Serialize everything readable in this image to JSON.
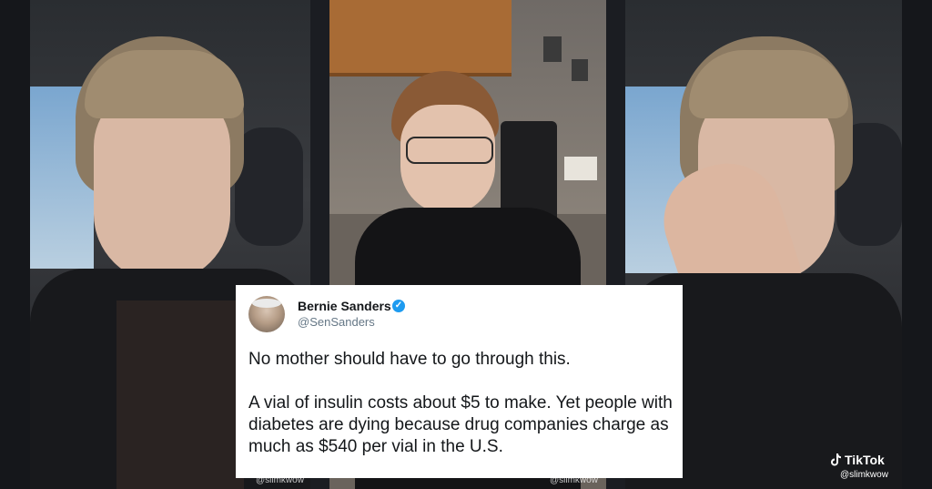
{
  "tweet": {
    "name": "Bernie Sanders",
    "handle": "@SenSanders",
    "paragraph_1": "No mother should have to go through this.",
    "paragraph_2": "A vial of insulin costs about $5 to make. Yet people with diabetes are dying because drug companies charge as much as $540 per vial in the U.S.",
    "verified_color": "#1d9bf0"
  },
  "watermarks": {
    "left": "@slimkwow",
    "middle": "@slimkwow"
  },
  "tiktok": {
    "brand": "TikTok",
    "username": "@slimkwow",
    "icon": "tiktok-note-icon"
  }
}
